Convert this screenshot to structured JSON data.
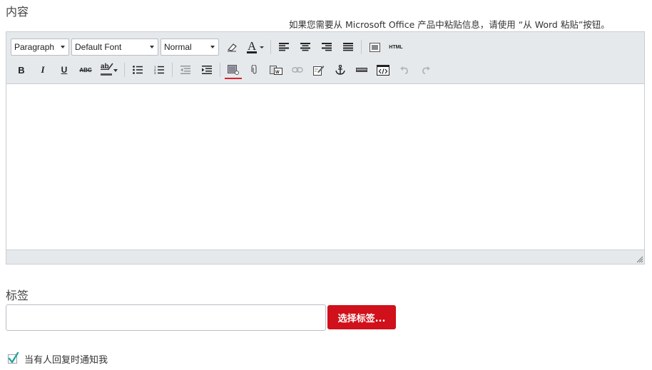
{
  "content_section": {
    "label": "内容",
    "paste_hint": "如果您需要从 Microsoft Office 产品中粘贴信息，请使用 “从 Word 粘贴”按钮。"
  },
  "editor": {
    "toolbar": {
      "format_select": "Paragraph",
      "font_select": "Default Font",
      "size_select": "Normal",
      "html_label": "HTML",
      "bold_label": "B",
      "italic_label": "I",
      "underline_label": "U",
      "strike_label": "ABC",
      "highlight_label": "ab"
    },
    "body_text": ""
  },
  "tags_section": {
    "label": "标签",
    "input_value": "",
    "choose_button": "选择标签..."
  },
  "notify": {
    "label": "当有人回复时通知我",
    "checked": true
  },
  "colors": {
    "accent_red": "#d0101a",
    "toolbar_bg": "#e6e9ec",
    "check_teal": "#2aa3a0"
  }
}
